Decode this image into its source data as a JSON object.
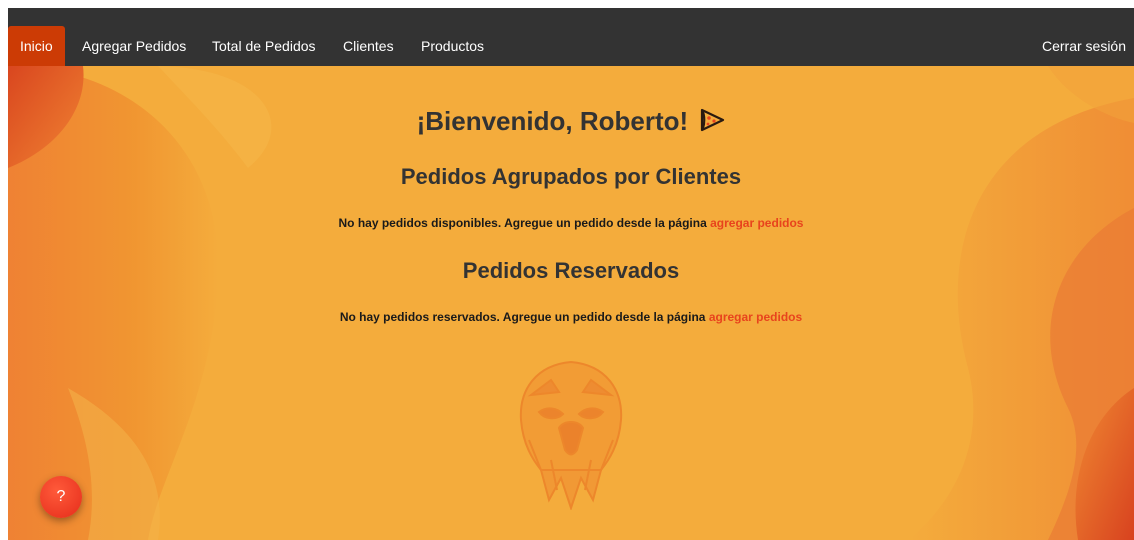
{
  "nav": {
    "items": [
      {
        "label": "Inicio"
      },
      {
        "label": "Agregar Pedidos"
      },
      {
        "label": "Total de Pedidos"
      },
      {
        "label": "Clientes"
      },
      {
        "label": "Productos"
      }
    ],
    "logout_label": "Cerrar sesión"
  },
  "welcome": {
    "text": "¡Bienvenido, Roberto!",
    "icon": "pizza-icon"
  },
  "grouped_orders": {
    "title": "Pedidos Agrupados por Clientes",
    "empty_text": "No hay pedidos disponibles. Agregue un pedido desde la página",
    "link_label": "agregar pedidos"
  },
  "reserved_orders": {
    "title": "Pedidos Reservados",
    "empty_text": "No hay pedidos reservados. Agregue un pedido desde la página",
    "link_label": "agregar pedidos"
  },
  "help": {
    "label": "?"
  },
  "colors": {
    "navbar": "#333333",
    "active_tab": "#cc3b05",
    "background": "#f4ac3c",
    "link": "#e8441d",
    "help_button": "#e52c1a",
    "heading": "#333333"
  }
}
